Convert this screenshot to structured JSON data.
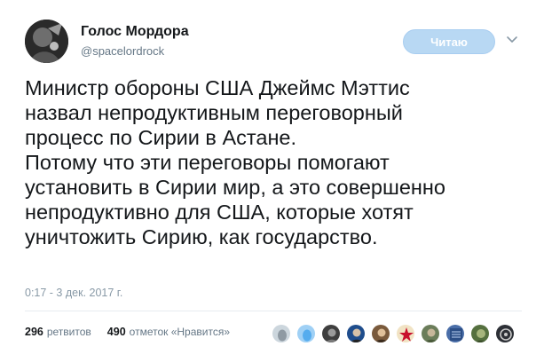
{
  "author": {
    "name": "Голос Мордора",
    "handle": "@spacelordrock"
  },
  "follow_button": {
    "label": "Читаю"
  },
  "tweet": {
    "lines": [
      "Министр обороны США Джеймс Мэттис",
      "назвал непродуктивным переговорный",
      "процесс по Сирии в Астане.",
      "Потому что эти переговоры помогают",
      "установить в Сирии мир, а это совершенно",
      "непродуктивно для США, которые хотят",
      "уничтожить Сирию, как государство."
    ],
    "timestamp": "0:17 - 3 дек. 2017 г."
  },
  "stats": {
    "retweets_count": "296",
    "retweets_label": "ретвитов",
    "likes_count": "490",
    "likes_label": "отметок «Нравится»"
  },
  "likers": [
    {
      "icon": "default-egg-avatar",
      "color": "#8f9aa3"
    },
    {
      "icon": "blue-egg-avatar",
      "color": "#55acee"
    },
    {
      "icon": "photo-avatar",
      "color": "#3e3e3e"
    },
    {
      "icon": "photo-avatar",
      "color": "#1f4d8c"
    },
    {
      "icon": "photo-avatar",
      "color": "#7a5a3c"
    },
    {
      "icon": "red-star-avatar",
      "color": "#c8102e"
    },
    {
      "icon": "photo-avatar",
      "color": "#6b7d5a"
    },
    {
      "icon": "photo-avatar",
      "color": "#4a6ea8"
    },
    {
      "icon": "photo-avatar",
      "color": "#55703f"
    },
    {
      "icon": "photo-avatar",
      "color": "#2d3036"
    }
  ],
  "colors": {
    "follow_button_bg": "#b8d8f3",
    "secondary_text": "#657786",
    "timestamp_text": "#8899a6",
    "divider": "#e6ecf0"
  }
}
